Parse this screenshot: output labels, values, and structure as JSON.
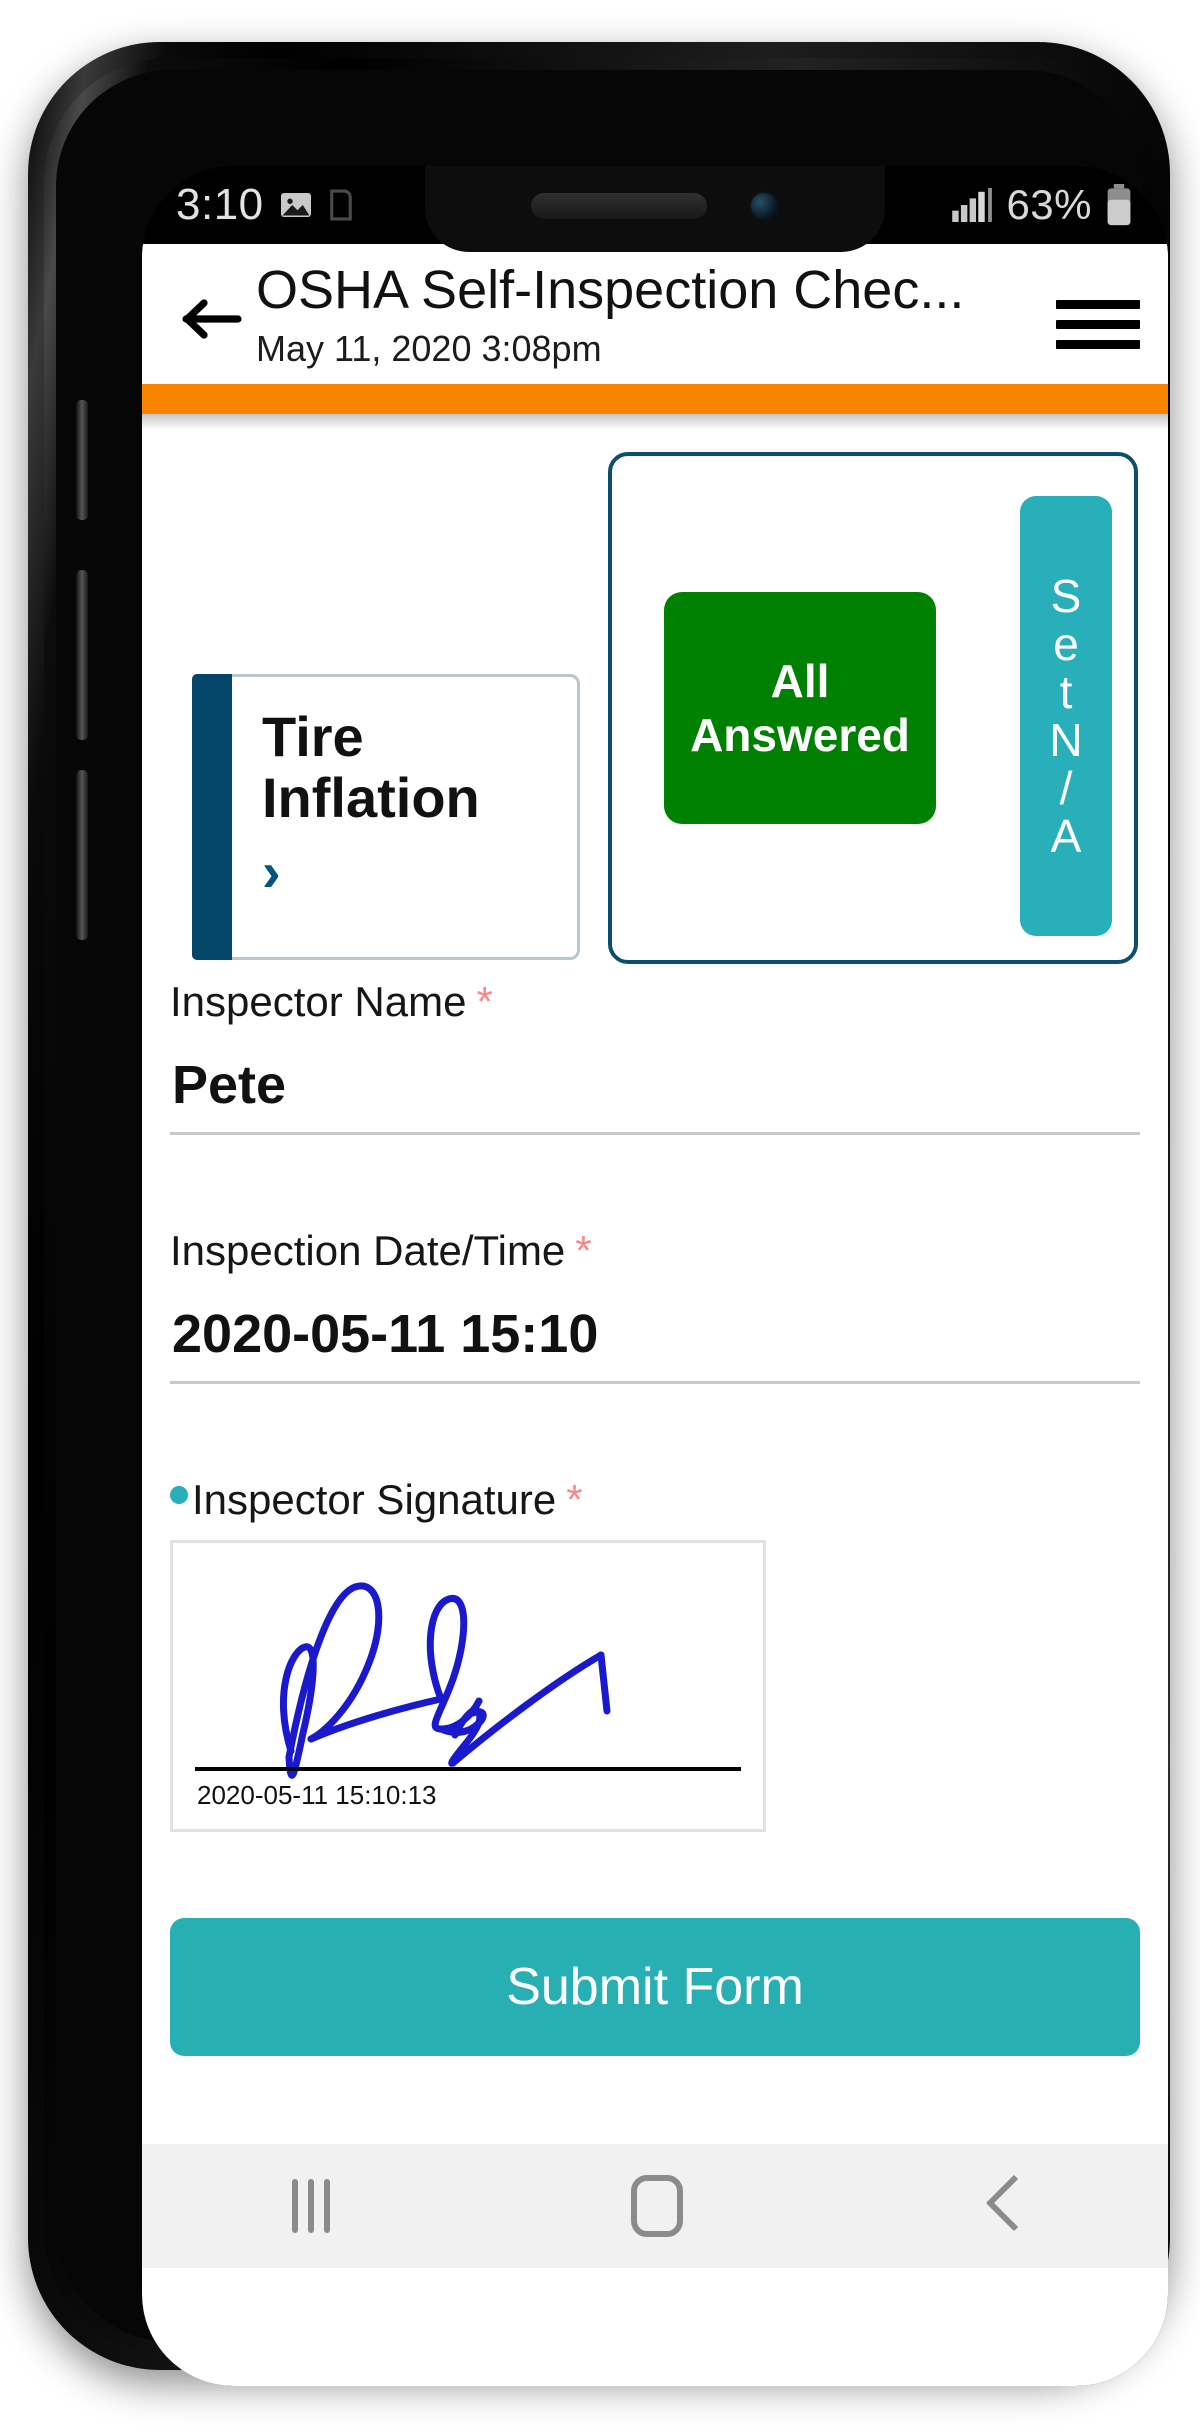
{
  "status_bar": {
    "time": "3:10",
    "battery_percent": "63%",
    "icons": [
      "image-icon",
      "signal-icon",
      "battery-icon"
    ]
  },
  "app_bar": {
    "back_label": "←",
    "title": "OSHA Self-Inspection Chec...",
    "subtitle": "May 11, 2020 3:08pm",
    "menu_label": "menu"
  },
  "progress": {
    "color": "#F98400",
    "percent": "100"
  },
  "section_card": {
    "title": "Tire Inflation",
    "chevron": "›",
    "accent_color": "#04456A"
  },
  "answer_card": {
    "border_color": "#0b4f6c",
    "all_answered_line1": "All",
    "all_answered_line2": "Answered",
    "all_answered_color": "#008000",
    "set_na_letters": [
      "S",
      "e",
      "t",
      "N",
      "/",
      "A"
    ],
    "set_na_label": "Set N/A",
    "set_na_color": "#29AFBA"
  },
  "fields": [
    {
      "label": "Inspector Name",
      "required": "*",
      "value": "Pete",
      "has_dot": false
    },
    {
      "label": "Inspection Date/Time",
      "required": "*",
      "value": "2020-05-11 15:10",
      "has_dot": false
    }
  ],
  "signature": {
    "label": "Inspector Signature",
    "required": "*",
    "timestamp": "2020-05-11 15:10:13",
    "ink_color": "#1A1ACC"
  },
  "submit": {
    "label": "Submit Form",
    "color": "#27AFB4"
  },
  "nav_bar": {
    "recents_label": "recents",
    "home_label": "home",
    "back_label": "back"
  }
}
